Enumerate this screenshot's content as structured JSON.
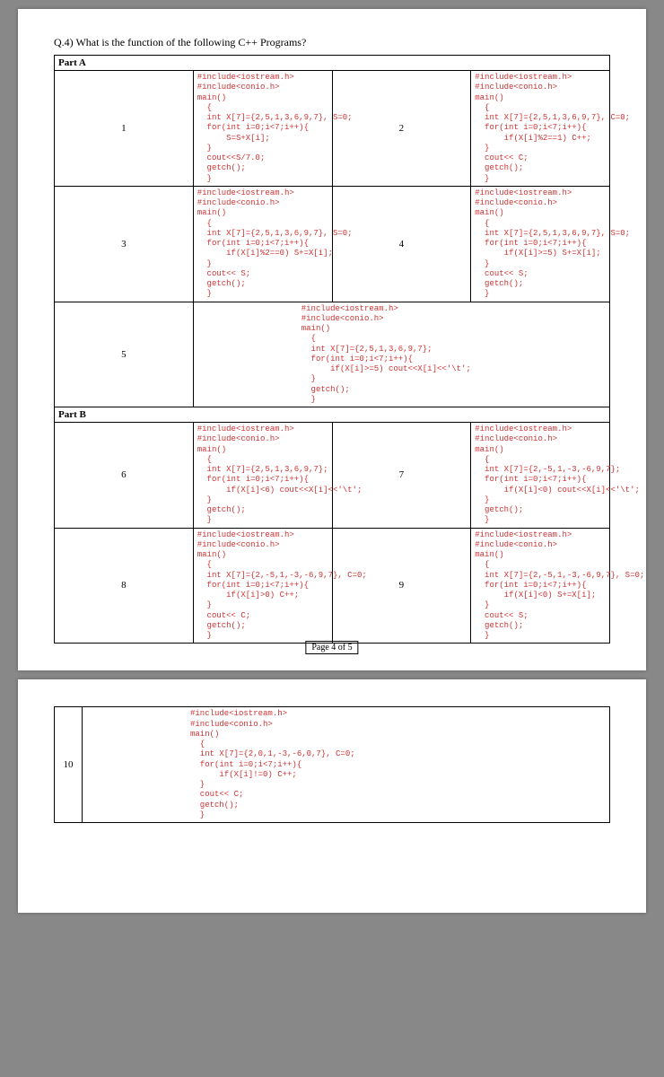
{
  "question": "Q.4)   What is the function of the following C++ Programs?",
  "partA_label": "Part A",
  "partB_label": "Part B",
  "pagenum": "Page 4 of 5",
  "cells": {
    "c1": "#include<iostream.h>\n#include<conio.h>\nmain()\n  {\n  int X[7]={2,5,1,3,6,9,7}, S=0;\n  for(int i=0;i<7;i++){\n      S=S+X[i];\n  }\n  cout<<S/7.0;\n  getch();\n  }",
    "c2": "#include<iostream.h>\n#include<conio.h>\nmain()\n  {\n  int X[7]={2,5,1,3,6,9,7}, C=0;\n  for(int i=0;i<7;i++){\n      if(X[i]%2==1) C++;\n  }\n  cout<< C;\n  getch();\n  }",
    "c3": "#include<iostream.h>\n#include<conio.h>\nmain()\n  {\n  int X[7]={2,5,1,3,6,9,7}, S=0;\n  for(int i=0;i<7;i++){\n      if(X[i]%2==0) S+=X[i];\n  }\n  cout<< S;\n  getch();\n  }",
    "c4": "#include<iostream.h>\n#include<conio.h>\nmain()\n  {\n  int X[7]={2,5,1,3,6,9,7}, S=0;\n  for(int i=0;i<7;i++){\n      if(X[i]>=5) S+=X[i];\n  }\n  cout<< S;\n  getch();\n  }",
    "c5": "#include<iostream.h>\n#include<conio.h>\nmain()\n  {\n  int X[7]={2,5,1,3,6,9,7};\n  for(int i=0;i<7;i++){\n      if(X[i]>=5) cout<<X[i]<<'\\t';\n  }\n  getch();\n  }",
    "c6": "#include<iostream.h>\n#include<conio.h>\nmain()\n  {\n  int X[7]={2,5,1,3,6,9,7};\n  for(int i=0;i<7;i++){\n      if(X[i]<6) cout<<X[i]<<'\\t';\n  }\n  getch();\n  }",
    "c7": "#include<iostream.h>\n#include<conio.h>\nmain()\n  {\n  int X[7]={2,-5,1,-3,-6,9,7};\n  for(int i=0;i<7;i++){\n      if(X[i]<0) cout<<X[i]<<'\\t';\n  }\n  getch();\n  }",
    "c8": "#include<iostream.h>\n#include<conio.h>\nmain()\n  {\n  int X[7]={2,-5,1,-3,-6,9,7}, C=0;\n  for(int i=0;i<7;i++){\n      if(X[i]>0) C++;\n  }\n  cout<< C;\n  getch();\n  }",
    "c9": "#include<iostream.h>\n#include<conio.h>\nmain()\n  {\n  int X[7]={2,-5,1,-3,-6,9,7}, S=0;\n  for(int i=0;i<7;i++){\n      if(X[i]<0) S+=X[i];\n  }\n  cout<< S;\n  getch();\n  }",
    "c10": "#include<iostream.h>\n#include<conio.h>\nmain()\n  {\n  int X[7]={2,0,1,-3,-6,0,7}, C=0;\n  for(int i=0;i<7;i++){\n      if(X[i]!=0) C++;\n  }\n  cout<< C;\n  getch();\n  }",
    "n1": "1",
    "n2": "2",
    "n3": "3",
    "n4": "4",
    "n5": "5",
    "n6": "6",
    "n7": "7",
    "n8": "8",
    "n9": "9",
    "n10": "10"
  }
}
